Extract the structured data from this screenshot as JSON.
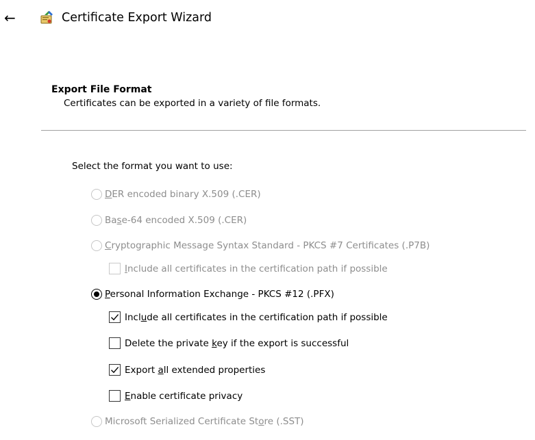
{
  "window": {
    "back_glyph": "←",
    "icon": "certificate-wizard-icon",
    "title": "Certificate Export Wizard"
  },
  "section": {
    "title": "Export File Format",
    "description": "Certificates can be exported in a variety of file formats."
  },
  "prompt": "Select the format you want to use:",
  "formats": [
    {
      "pre": "",
      "u": "D",
      "post": "ER encoded binary X.509 (.CER)",
      "selected": false,
      "enabled": false
    },
    {
      "pre": "Ba",
      "u": "s",
      "post": "e-64 encoded X.509 (.CER)",
      "selected": false,
      "enabled": false
    },
    {
      "pre": "",
      "u": "C",
      "post": "ryptographic Message Syntax Standard - PKCS #7 Certificates (.P7B)",
      "selected": false,
      "enabled": false
    },
    {
      "pre": "",
      "u": "P",
      "post": "ersonal Information Exchange - PKCS #12 (.PFX)",
      "selected": true,
      "enabled": true
    },
    {
      "pre": "Microsoft Serialized Certificate St",
      "u": "o",
      "post": "re (.SST)",
      "selected": false,
      "enabled": false
    }
  ],
  "p7b_options": [
    {
      "pre": "",
      "u": "I",
      "post": "nclude all certificates in the certification path if possible",
      "checked": false,
      "enabled": false
    }
  ],
  "pfx_options": [
    {
      "pre": "Incl",
      "u": "u",
      "post": "de all certificates in the certification path if possible",
      "checked": true,
      "enabled": true
    },
    {
      "pre": "Delete the private ",
      "u": "k",
      "post": "ey if the export is successful",
      "checked": false,
      "enabled": true
    },
    {
      "pre": "Export ",
      "u": "a",
      "post": "ll extended properties",
      "checked": true,
      "enabled": true
    },
    {
      "pre": "",
      "u": "E",
      "post": "nable certificate privacy",
      "checked": false,
      "enabled": true
    }
  ],
  "colors": {
    "disabled_text": "#8d8d8d",
    "divider": "#a0a0a0"
  }
}
